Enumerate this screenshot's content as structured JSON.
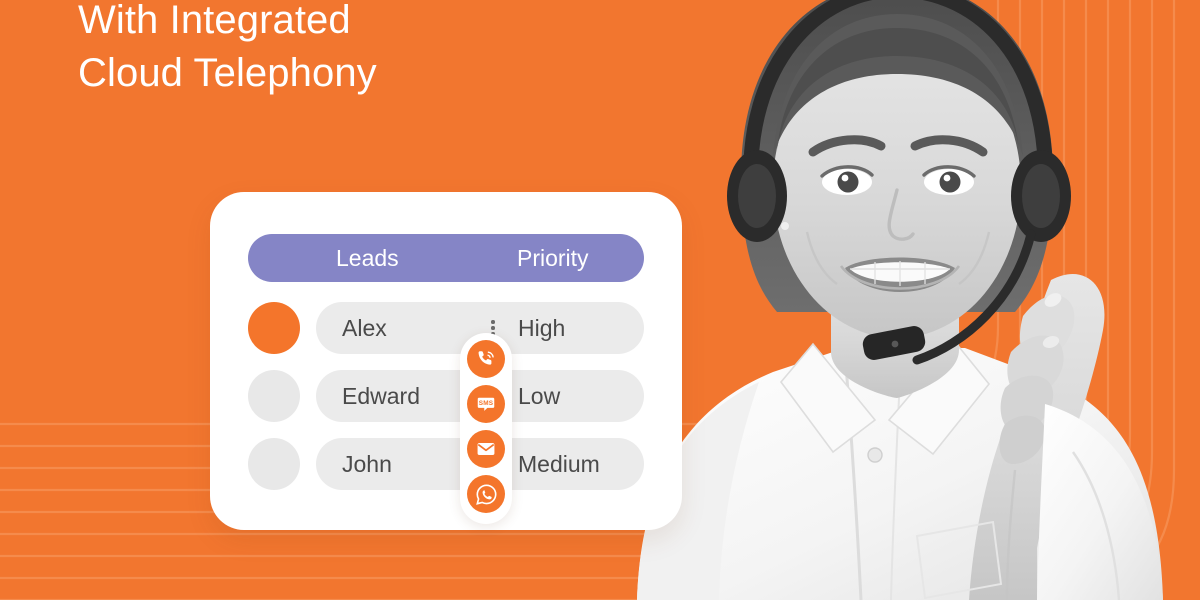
{
  "banner": {
    "background_color": "#F2762F",
    "headline_lines": [
      "With Integrated",
      "Cloud Telephony"
    ]
  },
  "photo": {
    "alt_name": "call-center-agent-photo",
    "description": "Smiling female call center agent wearing a headset, grayscale"
  },
  "card": {
    "background_color": "#FFFFFF",
    "header": {
      "background_color": "#8585C6",
      "leads_label": "Leads",
      "priority_label": "Priority"
    },
    "rows": [
      {
        "name": "Alex",
        "priority": "High",
        "avatar_color": "#F4752B",
        "active": true
      },
      {
        "name": "Edward",
        "priority": "Low",
        "avatar_color": "#E8E8E8",
        "active": false
      },
      {
        "name": "John",
        "priority": "Medium",
        "avatar_color": "#E8E8E8",
        "active": false
      }
    ],
    "row_menu_icon": "kebab-menu-icon"
  },
  "action_strip": {
    "accent_color": "#F4752B",
    "actions": [
      {
        "icon": "call-icon",
        "label": "Call"
      },
      {
        "icon": "sms-icon",
        "label": "SMS"
      },
      {
        "icon": "email-icon",
        "label": "Email"
      },
      {
        "icon": "whatsapp-icon",
        "label": "WhatsApp"
      }
    ],
    "sms_glyph_text": "SMS"
  }
}
